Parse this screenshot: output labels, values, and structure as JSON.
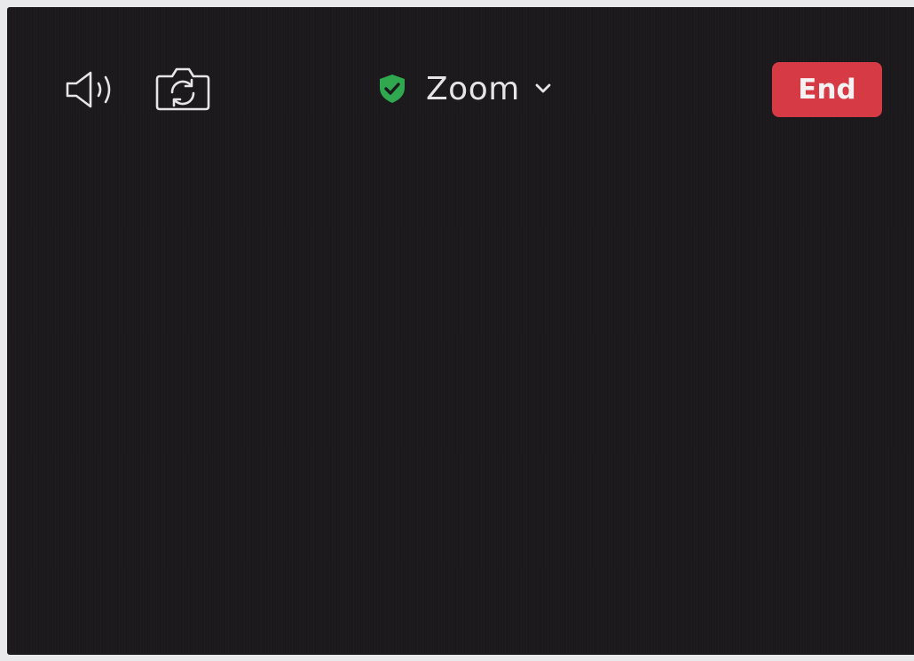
{
  "meeting": {
    "title": "Zoom",
    "encryption_status_icon": "shield-check-icon",
    "title_menu_icon": "chevron-down-icon"
  },
  "toolbar": {
    "speaker_icon": "speaker-icon",
    "switch_camera_icon": "switch-camera-icon",
    "end_label": "End"
  },
  "colors": {
    "background": "#1b191c",
    "end_button": "#d63a45",
    "shield": "#2fa84f",
    "text": "#e6e4e8"
  }
}
